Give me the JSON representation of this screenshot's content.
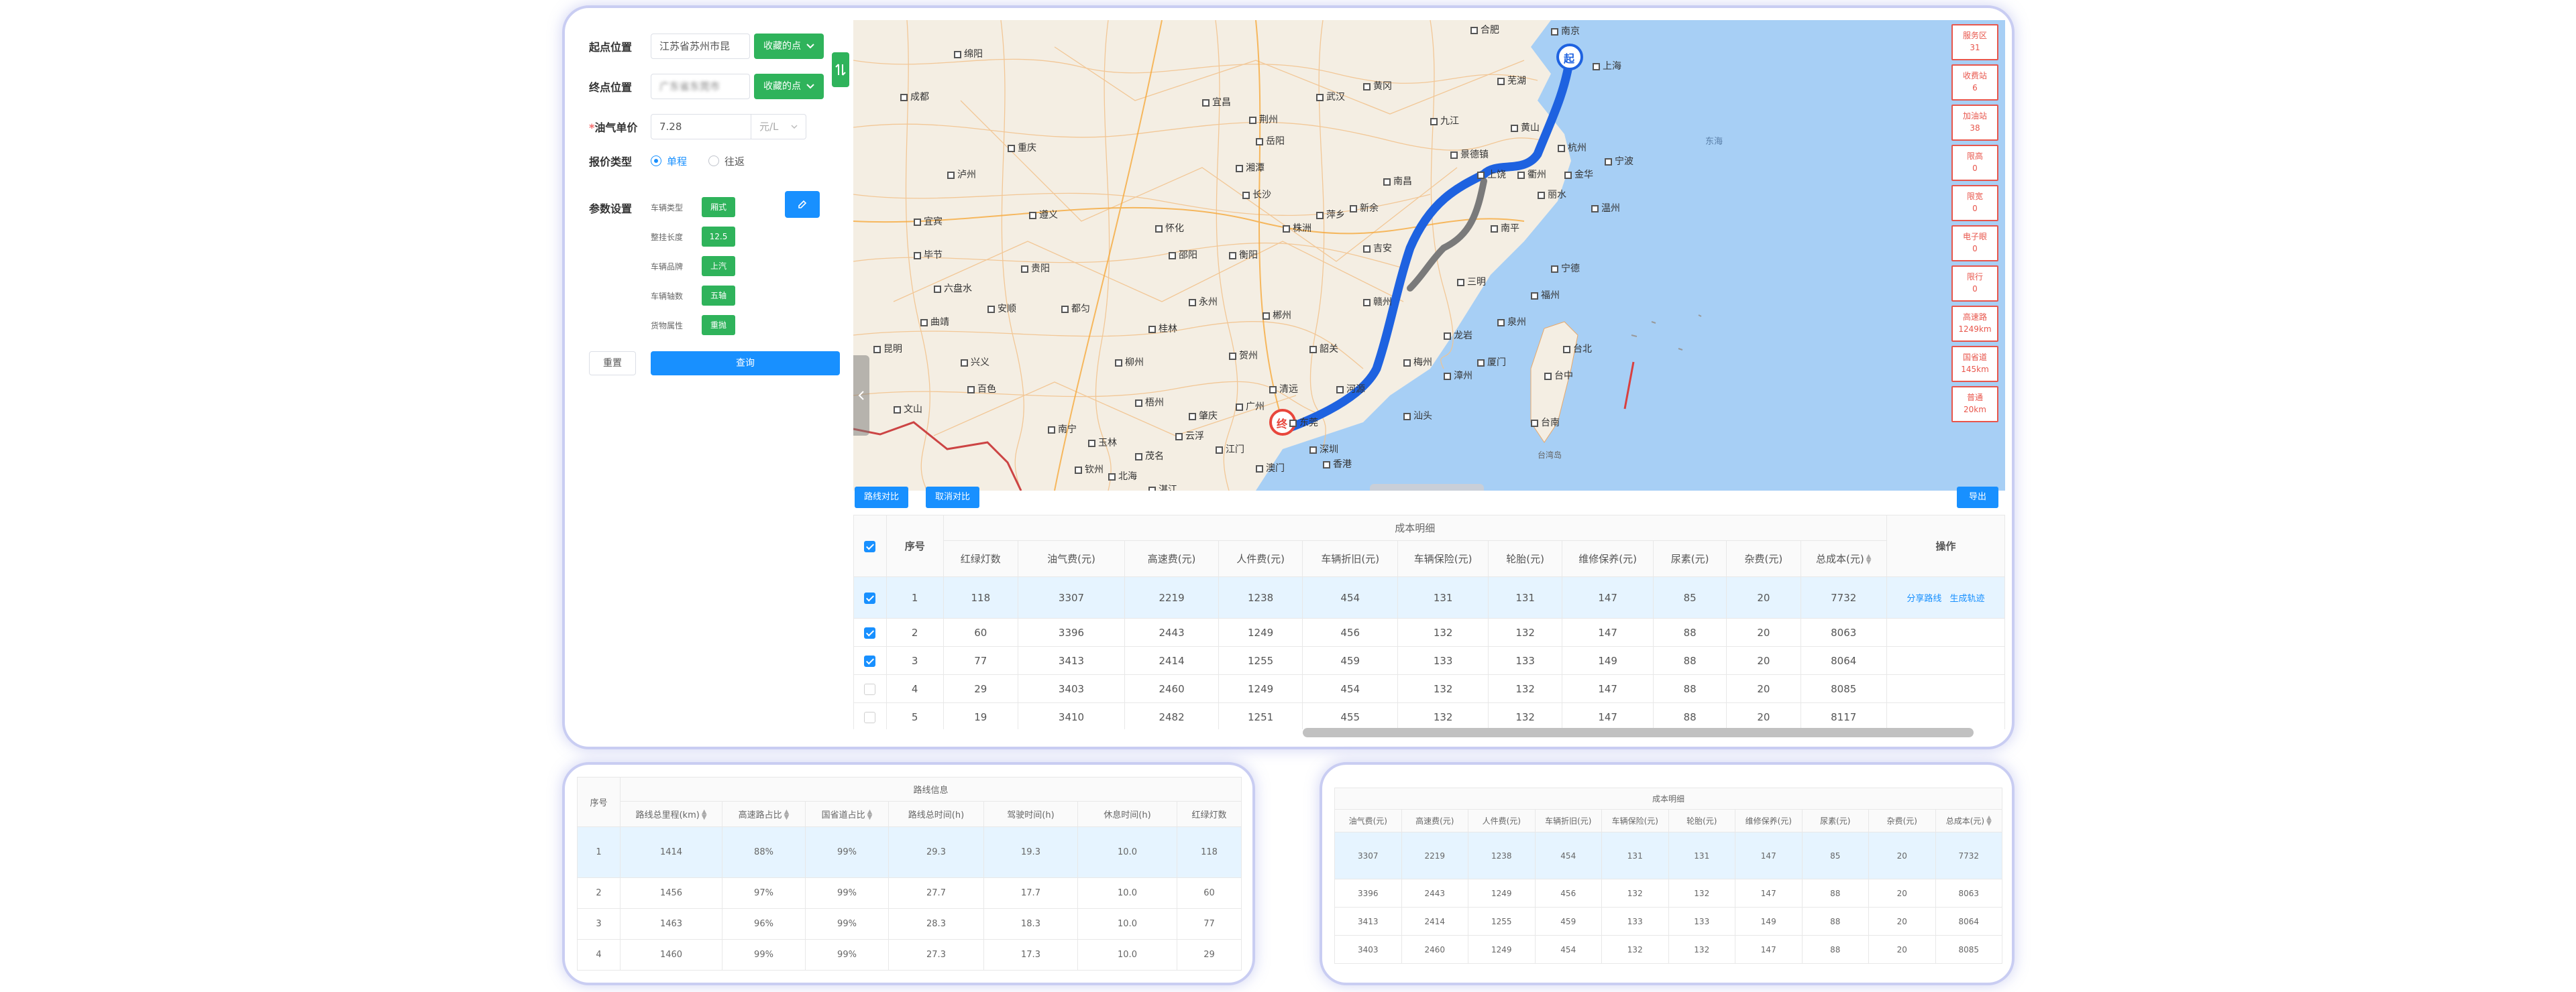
{
  "form": {
    "start_label": "起点位置",
    "start_value": "江苏省苏州市昆",
    "start_btn": "收藏的点",
    "end_label": "终点位置",
    "end_value": "广东省东莞市",
    "end_btn": "收藏的点",
    "swap_icon": "swap-icon",
    "fuel_label": "油气单价",
    "fuel_required": "*",
    "fuel_value": "7.28",
    "fuel_unit": "元/L",
    "quote_label": "报价类型",
    "quote_options": [
      "单程",
      "往返"
    ],
    "quote_selected": "单程",
    "param_label": "参数设置",
    "params": [
      {
        "name": "车辆类型",
        "value": "厢式"
      },
      {
        "name": "整挂长度",
        "value": "12.5"
      },
      {
        "name": "车辆品牌",
        "value": "上汽"
      },
      {
        "name": "车辆轴数",
        "value": "五轴"
      },
      {
        "name": "货物属性",
        "value": "重抛"
      }
    ],
    "edit_icon": "edit-icon",
    "reset_btn": "重置",
    "query_btn": "查询"
  },
  "map": {
    "start_marker": "起",
    "end_marker": "终",
    "collapse_icon": "chevron-left-icon",
    "cities": [
      "合肥",
      "南京",
      "上海",
      "芜湖",
      "武汉",
      "黄冈",
      "宜昌",
      "荆州",
      "成都",
      "绵阳",
      "宜宾",
      "贵阳",
      "遵义",
      "怀化",
      "长沙",
      "南昌",
      "景德镇",
      "杭州",
      "宁波",
      "温州",
      "丽水",
      "黄山",
      "岳阳",
      "衡阳",
      "株洲",
      "萍乡",
      "新余",
      "吉安",
      "赣州",
      "龙岩",
      "南平",
      "三明",
      "宁德",
      "福州",
      "泉州",
      "厦门",
      "漳州",
      "汕头",
      "梅州",
      "河源",
      "韶关",
      "清远",
      "广州",
      "东莞",
      "深圳",
      "香港",
      "澳门",
      "江门",
      "肇庆",
      "梧州",
      "玉林",
      "南宁",
      "柳州",
      "桂林",
      "百色",
      "钦州",
      "北海",
      "昆明",
      "曲靖",
      "文山",
      "六盘水",
      "台北",
      "台中",
      "台南",
      "九江",
      "上饶",
      "衢州",
      "金华",
      "湘潭",
      "邵阳",
      "永州",
      "郴州",
      "贺州",
      "云浮",
      "茂名",
      "湛江",
      "重庆",
      "泸州",
      "毕节",
      "都匀",
      "安顺",
      "兴义",
      "东海",
      "台湾岛"
    ],
    "side_buttons": [
      {
        "name": "服务区",
        "value": "31"
      },
      {
        "name": "收费站",
        "value": "6"
      },
      {
        "name": "加油站",
        "value": "38"
      },
      {
        "name": "限高",
        "value": "0"
      },
      {
        "name": "限宽",
        "value": "0"
      },
      {
        "name": "电子眼",
        "value": "0"
      },
      {
        "name": "限行",
        "value": "0"
      },
      {
        "name": "高速路",
        "value": "1249km"
      },
      {
        "name": "国省道",
        "value": "145km"
      },
      {
        "name": "普通",
        "value": "20km"
      }
    ]
  },
  "toolbar": {
    "compare_btn": "路线对比",
    "cancel_btn": "取消对比",
    "export_btn": "导出"
  },
  "main_table": {
    "group_header": "成本明细",
    "index_header": "序号",
    "ops_header": "操作",
    "columns": [
      "红绿灯数",
      "油气费(元)",
      "高速费(元)",
      "人件费(元)",
      "车辆折旧(元)",
      "车辆保险(元)",
      "轮胎(元)",
      "维修保养(元)",
      "尿素(元)",
      "杂费(元)",
      "总成本(元)"
    ],
    "rows": [
      {
        "checked": true,
        "index": "1",
        "cells": [
          "118",
          "3307",
          "2219",
          "1238",
          "454",
          "131",
          "131",
          "147",
          "85",
          "20",
          "7732"
        ],
        "ops": [
          "分享路线",
          "生成轨迹"
        ]
      },
      {
        "checked": true,
        "index": "2",
        "cells": [
          "60",
          "3396",
          "2443",
          "1249",
          "456",
          "132",
          "132",
          "147",
          "88",
          "20",
          "8063"
        ],
        "ops": []
      },
      {
        "checked": true,
        "index": "3",
        "cells": [
          "77",
          "3413",
          "2414",
          "1255",
          "459",
          "133",
          "133",
          "149",
          "88",
          "20",
          "8064"
        ],
        "ops": []
      },
      {
        "checked": false,
        "index": "4",
        "cells": [
          "29",
          "3403",
          "2460",
          "1249",
          "454",
          "132",
          "132",
          "147",
          "88",
          "20",
          "8085"
        ],
        "ops": []
      },
      {
        "checked": false,
        "index": "5",
        "cells": [
          "19",
          "3410",
          "2482",
          "1251",
          "455",
          "132",
          "132",
          "147",
          "88",
          "20",
          "8117"
        ],
        "ops": []
      }
    ]
  },
  "route_table": {
    "group_header": "路线信息",
    "index_header": "序号",
    "columns": [
      "路线总里程(km)",
      "高速路占比",
      "国省道占比",
      "路线总时间(h)",
      "驾驶时间(h)",
      "休息时间(h)",
      "红绿灯数"
    ],
    "rows": [
      {
        "index": "1",
        "cells": [
          "1414",
          "88%",
          "99%",
          "29.3",
          "19.3",
          "10.0",
          "118"
        ]
      },
      {
        "index": "2",
        "cells": [
          "1456",
          "97%",
          "99%",
          "27.7",
          "17.7",
          "10.0",
          "60"
        ]
      },
      {
        "index": "3",
        "cells": [
          "1463",
          "96%",
          "99%",
          "28.3",
          "18.3",
          "10.0",
          "77"
        ]
      },
      {
        "index": "4",
        "cells": [
          "1460",
          "99%",
          "99%",
          "27.3",
          "17.3",
          "10.0",
          "29"
        ]
      }
    ]
  },
  "cost_table": {
    "group_header": "成本明细",
    "columns": [
      "油气费(元)",
      "高速费(元)",
      "人件费(元)",
      "车辆折旧(元)",
      "车辆保险(元)",
      "轮胎(元)",
      "维修保养(元)",
      "尿素(元)",
      "杂费(元)",
      "总成本(元)"
    ],
    "rows": [
      [
        "3307",
        "2219",
        "1238",
        "454",
        "131",
        "131",
        "147",
        "85",
        "20",
        "7732"
      ],
      [
        "3396",
        "2443",
        "1249",
        "456",
        "132",
        "132",
        "147",
        "88",
        "20",
        "8063"
      ],
      [
        "3413",
        "2414",
        "1255",
        "459",
        "133",
        "133",
        "149",
        "88",
        "20",
        "8064"
      ],
      [
        "3403",
        "2460",
        "1249",
        "454",
        "132",
        "132",
        "147",
        "88",
        "20",
        "8085"
      ]
    ]
  },
  "colors": {
    "accent": "#1890ff",
    "green": "#2fb35b",
    "alert": "#e8564c",
    "selected_row": "#e6f4ff"
  }
}
